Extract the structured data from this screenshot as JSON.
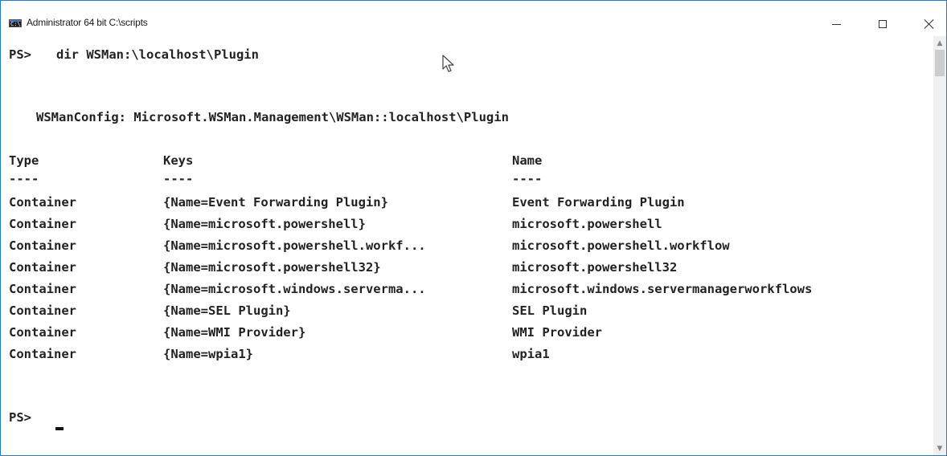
{
  "window": {
    "title": "Administrator 64 bit C:\\scripts",
    "icon": "console-icon",
    "icon_label": "C:\\"
  },
  "console": {
    "command_prompt": "PS>",
    "command": "dir WSMan:\\localhost\\Plugin",
    "config_header": "WSManConfig: Microsoft.WSMan.Management\\WSMan::localhost\\Plugin",
    "columns": {
      "type": "Type",
      "keys": "Keys",
      "name": "Name"
    },
    "separators": {
      "type": "----",
      "keys": "----",
      "name": "----"
    },
    "rows": [
      {
        "type": "Container",
        "keys": "{Name=Event Forwarding Plugin}",
        "name": "Event Forwarding Plugin"
      },
      {
        "type": "Container",
        "keys": "{Name=microsoft.powershell}",
        "name": "microsoft.powershell"
      },
      {
        "type": "Container",
        "keys": "{Name=microsoft.powershell.workf...",
        "name": "microsoft.powershell.workflow"
      },
      {
        "type": "Container",
        "keys": "{Name=microsoft.powershell32}",
        "name": "microsoft.powershell32"
      },
      {
        "type": "Container",
        "keys": "{Name=microsoft.windows.serverma...",
        "name": "microsoft.windows.servermanagerworkflows"
      },
      {
        "type": "Container",
        "keys": "{Name=SEL Plugin}",
        "name": "SEL Plugin"
      },
      {
        "type": "Container",
        "keys": "{Name=WMI Provider}",
        "name": "WMI Provider"
      },
      {
        "type": "Container",
        "keys": "{Name=wpia1}",
        "name": "wpia1"
      }
    ],
    "final_prompt": "PS>"
  },
  "colors": {
    "window_border": "#2b79c2",
    "text": "#222222",
    "background": "#ffffff"
  }
}
